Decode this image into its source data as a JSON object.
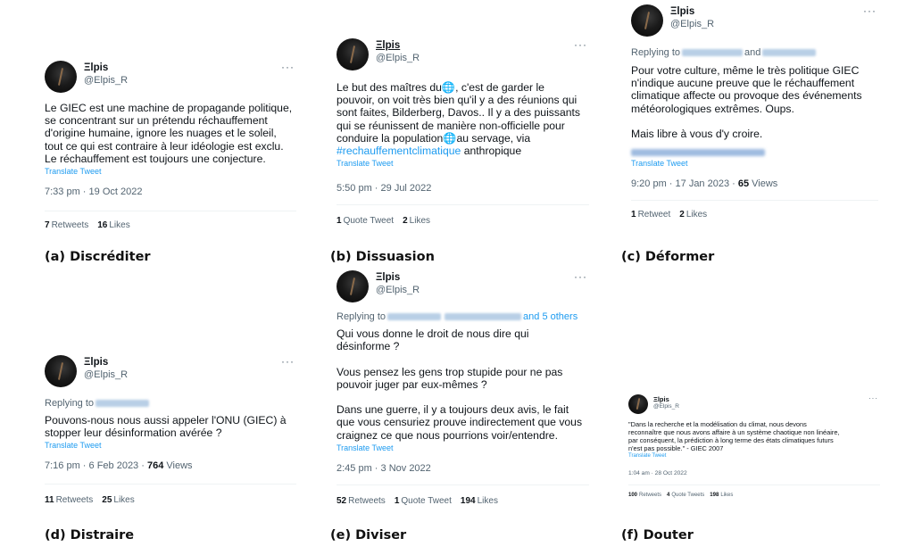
{
  "tweets": {
    "a": {
      "name": "Ξlpis",
      "handle": "@Elpis_R",
      "more": "···",
      "text": "Le GIEC est une machine de propagande politique,\nse concentrant sur un prétendu réchauffement\nd'origine humaine, ignore les nuages et le soleil,\ntout ce qui est contraire à leur idéologie est exclu.\nLe réchauffement est toujours une conjecture.",
      "translate": "Translate Tweet",
      "timestamp": "7:33 pm · 19 Oct 2022",
      "retweets_count": "7",
      "retweets_label": "Retweets",
      "likes_count": "16",
      "likes_label": "Likes"
    },
    "b": {
      "name": "Ξlpis",
      "handle": "@Elpis_R",
      "more": "···",
      "text_1": "Le but des maîtres du",
      "text_2": ", c'est de garder le\npouvoir, on voit très bien qu'il y a des réunions qui\nsont faites, Bilderberg, Davos..  Il y a des puissants\nqui se réunissent de manière non-officielle pour\nconduire la population",
      "text_3": "au servage, via\n",
      "hashtag": "#rechauffementclimatique",
      "text_4": " anthropique",
      "globe_icon": "globe-icon",
      "translate": "Translate Tweet",
      "timestamp": "5:50 pm · 29 Jul 2022",
      "quote_count": "1",
      "quote_label": "Quote Tweet",
      "likes_count": "2",
      "likes_label": "Likes"
    },
    "c": {
      "name": "Ξlpis",
      "handle": "@Elpis_R",
      "more": "···",
      "replying_to": "Replying to",
      "replying_and": "and",
      "text": "Pour votre culture, même le très politique GIEC\nn'indique aucune preuve que le réchauffement\nclimatique affecte ou provoque des événements\nmétéorologiques extrêmes. Oups.\n\nMais libre à vous d'y croire.",
      "translate": "Translate Tweet",
      "timestamp": "9:20 pm · 17 Jan 2023 · ",
      "views_count": "65",
      "views_label": " Views",
      "retweets_count": "1",
      "retweets_label": "Retweet",
      "likes_count": "2",
      "likes_label": "Likes"
    },
    "d": {
      "name": "Ξlpis",
      "handle": "@Elpis_R",
      "more": "···",
      "replying_to": "Replying to",
      "text": "Pouvons-nous nous aussi appeler l'ONU (GIEC) à\nstopper leur désinformation avérée ?",
      "translate": "Translate Tweet",
      "timestamp": "7:16 pm · 6 Feb 2023 · ",
      "views_count": "764",
      "views_label": " Views",
      "retweets_count": "11",
      "retweets_label": "Retweets",
      "likes_count": "25",
      "likes_label": "Likes"
    },
    "e": {
      "name": "Ξlpis",
      "handle": "@Elpis_R",
      "more": "···",
      "replying_to": "Replying to",
      "replying_tail": "and 5 others",
      "text": "Qui vous donne le droit de nous dire qui\ndésinforme ?\n\nVous pensez les gens trop stupide pour ne pas\npouvoir juger par eux-mêmes ?\n\nDans une guerre, il y a toujours deux avis, le fait\nque vous censuriez prouve indirectement que vous\ncraignez ce que nous pourrions voir/entendre.",
      "translate": "Translate Tweet",
      "timestamp": "2:45 pm · 3 Nov 2022",
      "retweets_count": "52",
      "retweets_label": "Retweets",
      "quote_count": "1",
      "quote_label": "Quote Tweet",
      "likes_count": "194",
      "likes_label": "Likes"
    },
    "f": {
      "name": "Ξlpis",
      "handle": "@Elpis_R",
      "more": "···",
      "text": "\"Dans la recherche et la modélisation du climat, nous devons\nreconnaître que nous avons affaire à un système chaotique non linéaire,\npar conséquent, la prédiction à long terme des états climatiques futurs\nn'est pas possible.\" - GIEC 2007",
      "translate": "Translate Tweet",
      "timestamp": "1:04 am · 28 Oct 2022",
      "retweets_count": "100",
      "retweets_label": "Retweets",
      "quote_count": "4",
      "quote_label": "Quote Tweets",
      "likes_count": "198",
      "likes_label": "Likes"
    }
  },
  "captions": {
    "a": "(a) Discréditer",
    "b": "(b) Dissuasion",
    "c": "(c) Déformer",
    "d": "(d) Distraire",
    "e": "(e) Diviser",
    "f": "(f) Douter"
  }
}
